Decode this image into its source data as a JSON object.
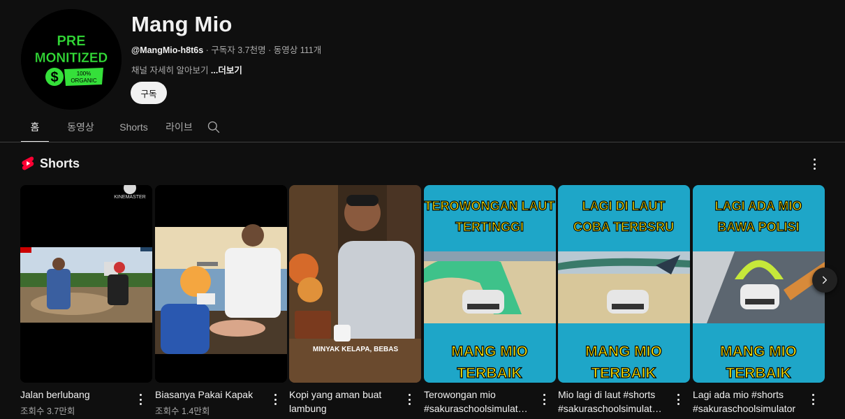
{
  "channel": {
    "name": "Mang Mio",
    "handle": "@MangMio-h8t6s",
    "stats": " · 구독자 3.7천명 · 동영상 111개",
    "description": "채널 자세히 알아보기 ",
    "more_label": "...더보기",
    "subscribe_label": "구독",
    "avatar_text": {
      "line1": "PRE",
      "line2": "MONITIZED",
      "badge1": "100%",
      "badge2": "ORGANIC",
      "symbol": "$"
    }
  },
  "tabs": [
    {
      "label": "홈",
      "active": true
    },
    {
      "label": "동영상",
      "active": false
    },
    {
      "label": "Shorts",
      "active": false
    },
    {
      "label": "라이브",
      "active": false
    }
  ],
  "section": {
    "title": "Shorts"
  },
  "shorts": [
    {
      "title": "Jalan berlubang",
      "views": "조회수 3.7만회",
      "overlay_top": "KINEMASTER"
    },
    {
      "title": "Biasanya Pakai Kapak",
      "views": "조회수 1.4만회"
    },
    {
      "title": "Kopi yang aman buat lambung",
      "views": "",
      "caption": "MINYAK KELAPA, BEBAS"
    },
    {
      "title": "Terowongan mio #sakuraschoolsimulat…",
      "views": "",
      "top_text1": "TEROWONGAN LAUT",
      "top_text2": "TERTINGGI",
      "bottom_text1": "MANG MIO",
      "bottom_text2": "TERBAIK"
    },
    {
      "title": "Mio lagi di laut #shorts #sakuraschoolsimulat…",
      "views": "",
      "top_text1": "LAGI DI LAUT",
      "top_text2": "COBA TERBSRU",
      "bottom_text1": "MANG MIO",
      "bottom_text2": "TERBAIK"
    },
    {
      "title": "Lagi ada mio #shorts #sakuraschoolsimulator",
      "views": "",
      "top_text1": "LAGI ADA MIO",
      "top_text2": "BAWA POLISI",
      "bottom_text1": "MANG MIO",
      "bottom_text2": "TERBAIK"
    }
  ],
  "colors": {
    "background": "#0f0f0f",
    "text_primary": "#f1f1f1",
    "text_secondary": "#aaaaaa",
    "shorts_red": "#ff0033",
    "game_cyan": "#1ea6c8",
    "game_yellow": "#ffe600",
    "avatar_green": "#35e03a"
  }
}
